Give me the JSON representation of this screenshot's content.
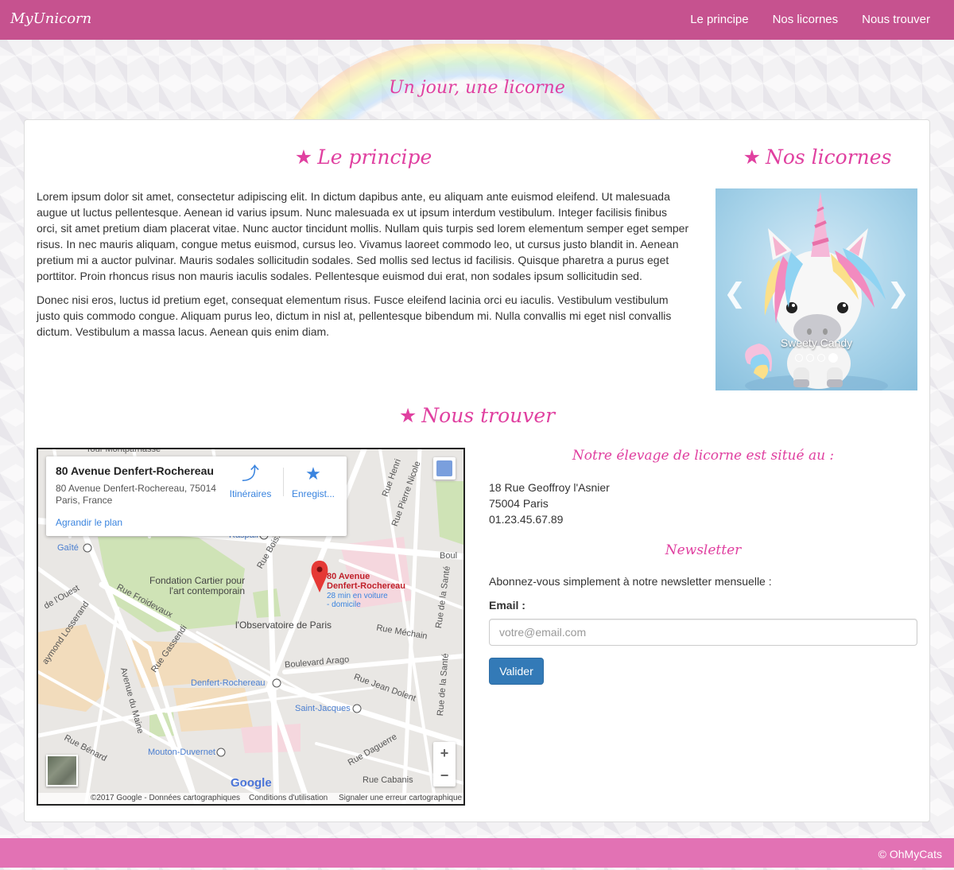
{
  "navbar": {
    "brand": "MyUnicorn",
    "links": [
      "Le principe",
      "Nos licornes",
      "Nous trouver"
    ]
  },
  "tagline": "Un jour, une licorne",
  "principe": {
    "title": "Le principe",
    "paragraphs": [
      "Lorem ipsum dolor sit amet, consectetur adipiscing elit. In dictum dapibus ante, eu aliquam ante euismod eleifend. Ut malesuada augue ut luctus pellentesque. Aenean id varius ipsum. Nunc malesuada ex ut ipsum interdum vestibulum. Integer facilisis finibus orci, sit amet pretium diam placerat vitae. Nunc auctor tincidunt mollis. Nullam quis turpis sed lorem elementum semper eget semper risus. In nec mauris aliquam, congue metus euismod, cursus leo. Vivamus laoreet commodo leo, ut cursus justo blandit in. Aenean pretium mi a auctor pulvinar. Mauris sodales sollicitudin sodales. Sed mollis sed lectus id facilisis. Quisque pharetra a purus eget porttitor. Proin rhoncus risus non mauris iaculis sodales. Pellentesque euismod dui erat, non sodales ipsum sollicitudin sed.",
      "Donec nisi eros, luctus id pretium eget, consequat elementum risus. Fusce eleifend lacinia orci eu iaculis. Vestibulum vestibulum justo quis commodo congue. Aliquam purus leo, dictum in nisl at, pellentesque bibendum mi. Nulla convallis mi eget nisl convallis dictum. Vestibulum a massa lacus. Aenean quis enim diam."
    ]
  },
  "licornes": {
    "title": "Nos licornes",
    "caption": "Sweety Candy",
    "slide_count": 4,
    "active_slide": 4
  },
  "trouver": {
    "title": "Nous trouver",
    "address_title": "Notre élevage de licorne est situé au :",
    "address_lines": [
      "18 Rue Geoffroy l'Asnier",
      "75004 Paris",
      "01.23.45.67.89"
    ]
  },
  "map": {
    "card_title": "80 Avenue Denfert-Rochereau",
    "card_address": "80 Avenue Denfert-Rochereau, 75014 Paris, France",
    "directions_label": "Itinéraires",
    "save_label": "Enregist...",
    "enlarge_label": "Agrandir le plan",
    "pin_label_1": "80 Avenue",
    "pin_label_2": "Denfert-Rochereau",
    "pin_sub_1": "28 min en voiture",
    "pin_sub_2": "- domicile",
    "logo": "Google",
    "footer_copyright": "©2017 Google - Données cartographiques",
    "footer_terms": "Conditions d'utilisation",
    "footer_report": "Signaler une erreur cartographique",
    "labels": {
      "tour": "Tour Montparnasse",
      "gaite": "Gaîté",
      "raspail": "Raspail",
      "fondation1": "Fondation Cartier pour",
      "fondation2": "l'art contemporain",
      "observatoire": "l'Observatoire de Paris",
      "arago": "Boulevard Arago",
      "denfert": "Denfert-Rochereau",
      "saintjacques": "Saint-Jacques",
      "mouton": "Mouton-Duvernet",
      "froidevaux": "Rue Froidevaux",
      "gassendi": "Rue Gassendi",
      "maine": "Avenue du Maine",
      "benard": "Rue Bénard",
      "daguerre": "Rue Daguerre",
      "cabanis": "Rue Cabanis",
      "mechain": "Rue Méchain",
      "jeandolent": "Rue Jean Dolent",
      "sante": "Rue de la Santé",
      "henri": "Rue Henri",
      "pierrenicole": "Rue Pierre Nicole",
      "boissonade": "Rue Bois...",
      "ouest": "de l'Ouest",
      "losserand": "aymond Losserand",
      "boul": "Boul"
    },
    "zoom_in": "+",
    "zoom_out": "−"
  },
  "newsletter": {
    "title": "Newsletter",
    "text": "Abonnez-vous simplement à notre newsletter mensuelle :",
    "email_label": "Email :",
    "email_placeholder": "votre@email.com",
    "submit_label": "Valider"
  },
  "footer": {
    "text": "© OhMyCats"
  },
  "colors": {
    "navbar": "#c6528f",
    "accent": "#e040a0",
    "footer": "#e272b4",
    "button": "#337ab7"
  }
}
